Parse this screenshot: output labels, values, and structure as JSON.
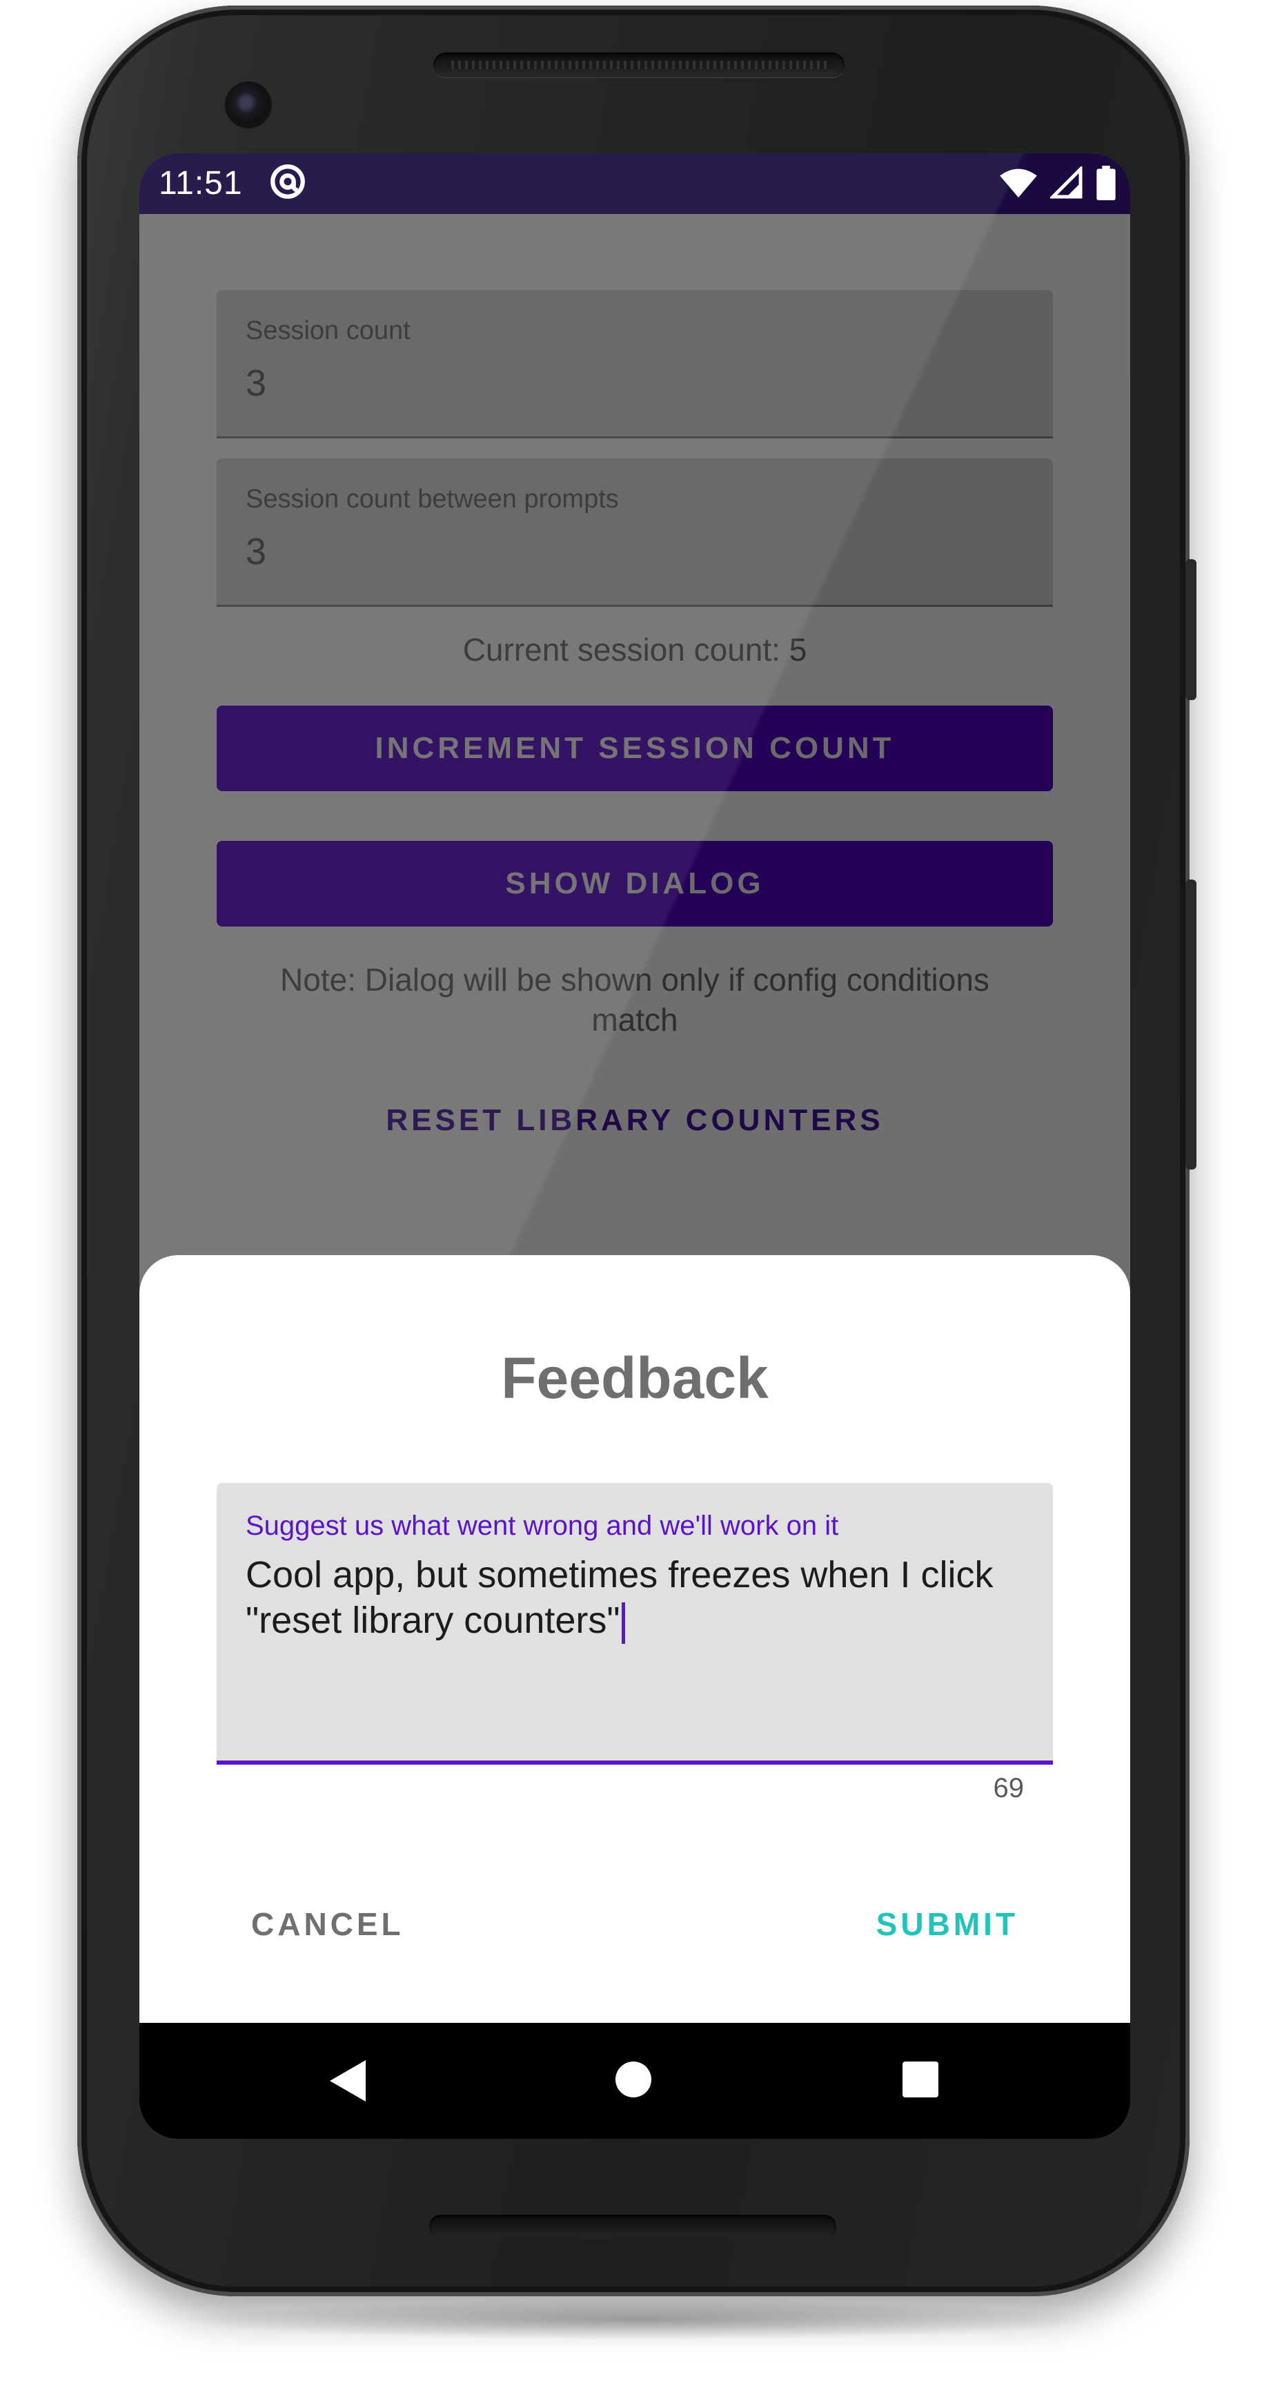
{
  "status_bar": {
    "time": "11:51",
    "icons": [
      "at-sign-icon",
      "wifi-icon",
      "signal-icon",
      "battery-icon"
    ]
  },
  "background_app": {
    "session_count": {
      "label": "Session count",
      "value": "3"
    },
    "session_between": {
      "label": "Session count between prompts",
      "value": "3"
    },
    "current_session": "Current session count: 5",
    "increment_button": "INCREMENT SESSION COUNT",
    "show_dialog_button": "SHOW DIALOG",
    "note": "Note: Dialog will be shown only if config conditions match",
    "reset_button": "RESET LIBRARY COUNTERS"
  },
  "feedback_sheet": {
    "title": "Feedback",
    "input_hint": "Suggest us what went wrong and we'll work on it",
    "input_value": "Cool app, but sometimes freezes when I click \"reset library counters\"",
    "char_count": "69",
    "cancel_label": "CANCEL",
    "submit_label": "SUBMIT"
  },
  "nav_bar": {
    "icons": [
      "back-icon",
      "home-icon",
      "recents-icon"
    ]
  },
  "colors": {
    "accent": "#5b14c9",
    "submit": "#21c3bb",
    "status_bar": "#1a0a40",
    "primary_button": "#250058"
  }
}
